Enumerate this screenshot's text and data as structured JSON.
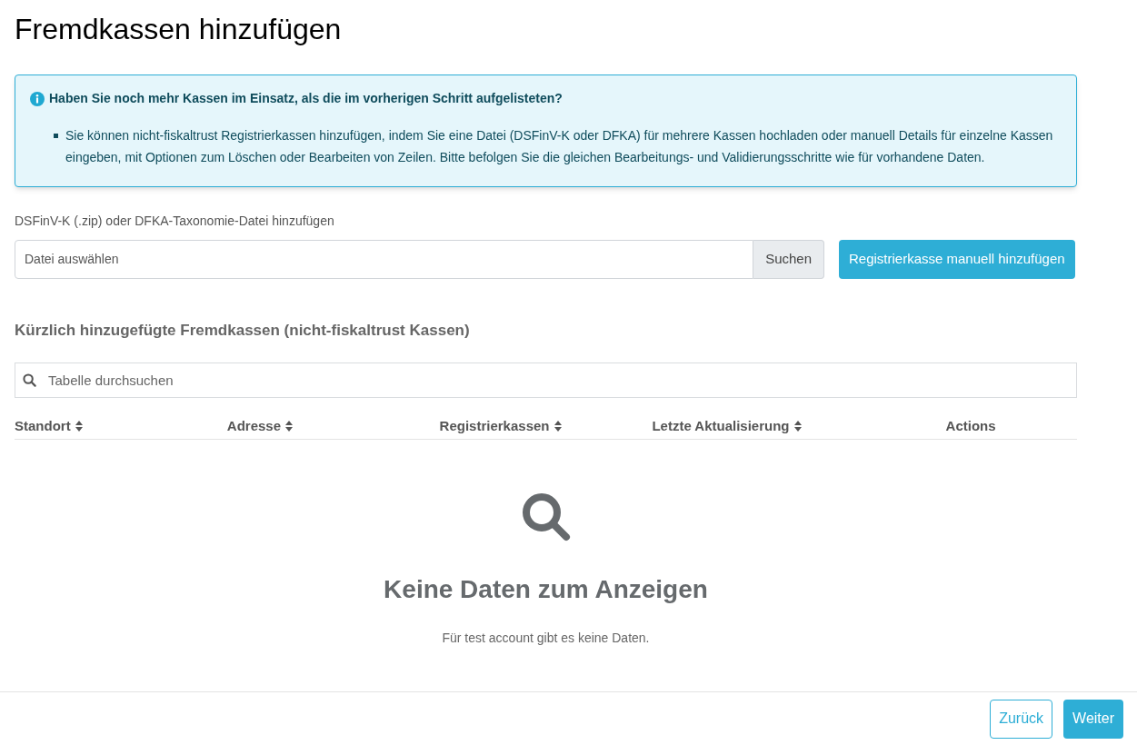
{
  "page": {
    "title": "Fremdkassen hinzufügen"
  },
  "alert": {
    "heading": "Haben Sie noch mehr Kassen im Einsatz, als die im vorherigen Schritt aufgelisteten?",
    "items": [
      "Sie können nicht-fiskaltrust Registrierkassen hinzufügen, indem Sie eine Datei (DSFinV-K oder DFKA) für mehrere Kassen hochladen oder manuell Details für einzelne Kassen eingeben, mit Optionen zum Löschen oder Bearbeiten von Zeilen. Bitte befolgen Sie die gleichen Bearbeitungs- und Validierungsschritte wie für vorhandene Daten."
    ]
  },
  "upload": {
    "label": "DSFinV-K (.zip) oder DFKA-Taxonomie-Datei hinzufügen",
    "placeholder": "Datei auswählen",
    "browse_button": "Suchen",
    "manual_button": "Registrierkasse manuell hinzufügen"
  },
  "table": {
    "heading": "Kürzlich hinzugefügte Fremdkassen (nicht-fiskaltrust Kassen)",
    "search_placeholder": "Tabelle durchsuchen",
    "columns": [
      {
        "label": "Standort",
        "sortable": true
      },
      {
        "label": "Adresse",
        "sortable": true
      },
      {
        "label": "Registrierkassen",
        "sortable": true
      },
      {
        "label": "Letzte Aktualisierung",
        "sortable": true
      },
      {
        "label": "Actions",
        "sortable": false
      }
    ],
    "empty": {
      "title": "Keine Daten zum Anzeigen",
      "message": "Für test account gibt es keine Daten."
    }
  },
  "footer": {
    "buttons": [
      {
        "label": "Zurück",
        "kind": "outline"
      },
      {
        "label": "Weiter",
        "kind": "primary"
      }
    ]
  }
}
